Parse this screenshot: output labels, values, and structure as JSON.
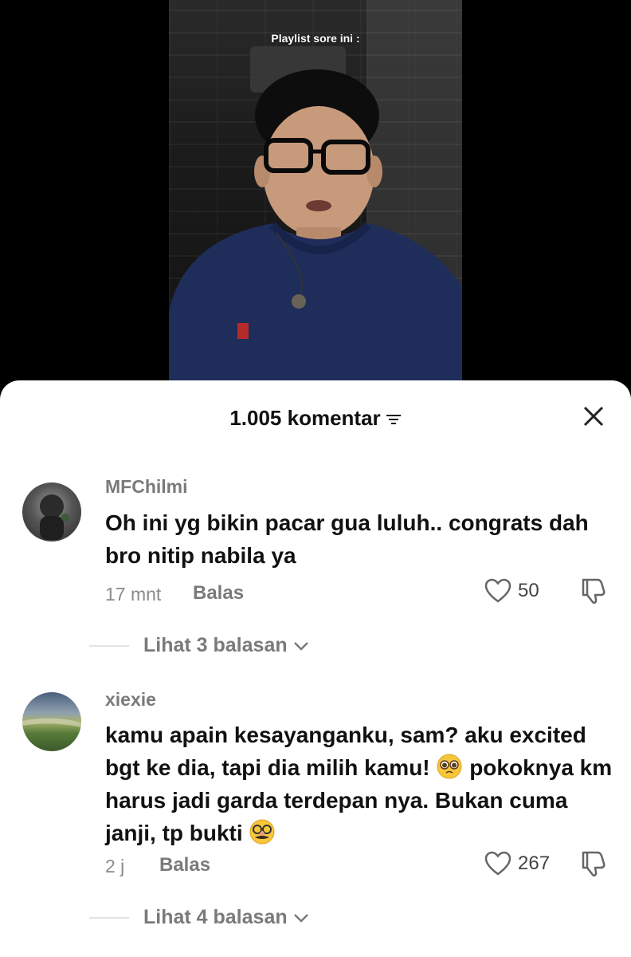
{
  "video": {
    "caption": "Playlist sore ini :"
  },
  "comments_sheet": {
    "title": "1.005 komentar",
    "comments": [
      {
        "username": "MFChilmi",
        "text": "Oh ini yg bikin pacar gua luluh.. congrats dah bro nitip nabila ya",
        "time": "17 mnt",
        "reply_label": "Balas",
        "likes": "50",
        "view_replies": "Lihat 3 balasan"
      },
      {
        "username": "xiexie",
        "text_part1": "kamu apain kesayanganku, sam? aku excited bgt ke dia, tapi dia milih kamu!",
        "text_part2": "pokoknya km harus jadi garda terdepan nya. Bukan cuma janji, tp bukti",
        "time": "2 j",
        "reply_label": "Balas",
        "likes": "267",
        "view_replies": "Lihat 4 balasan"
      }
    ]
  },
  "icons": {
    "filter": "filter-icon",
    "close": "close-icon",
    "heart": "heart-icon",
    "dislike": "thumbs-down-icon",
    "chevron": "chevron-down-icon",
    "pleading_emoji": "pleading-face-emoji",
    "disguise_emoji": "disguised-face-emoji"
  },
  "colors": {
    "sheet_bg": "#ffffff",
    "text_primary": "#111111",
    "text_muted": "#7a7a7a",
    "background": "#000000"
  }
}
